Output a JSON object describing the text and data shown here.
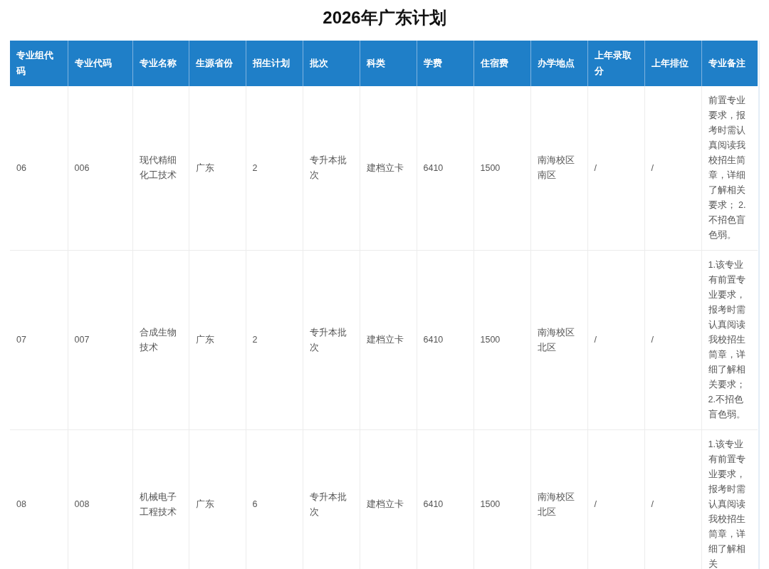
{
  "title": "2026年广东计划",
  "table": {
    "columns": [
      "专业组代码",
      "专业代码",
      "专业名称",
      "生源省份",
      "招生计划",
      "批次",
      "科类",
      "学费",
      "住宿费",
      "办学地点",
      "上年录取分",
      "上年排位",
      "专业备注"
    ],
    "rows": [
      {
        "cells": [
          "06",
          "006",
          "现代精细化工技术",
          "广东",
          "2",
          "专升本批次",
          "建档立卡",
          "6410",
          "1500",
          "南海校区南区",
          "/",
          "/",
          "前置专业要求，报考时需认真阅读我校招生简章，详细了解相关要求； 2.不招色盲色弱。"
        ]
      },
      {
        "cells": [
          "07",
          "007",
          "合成生物技术",
          "广东",
          "2",
          "专升本批次",
          "建档立卡",
          "6410",
          "1500",
          "南海校区北区",
          "/",
          "/",
          "1.该专业有前置专业要求，报考时需认真阅读我校招生简章，详细了解相关要求； 2.不招色盲色弱。"
        ]
      },
      {
        "cells": [
          "08",
          "008",
          "机械电子工程技术",
          "广东",
          "6",
          "专升本批次",
          "建档立卡",
          "6410",
          "1500",
          "南海校区北区",
          "/",
          "/",
          "1.该专业有前置专业要求，报考时需认真阅读我校招生简章，详细了解相关"
        ]
      }
    ]
  }
}
